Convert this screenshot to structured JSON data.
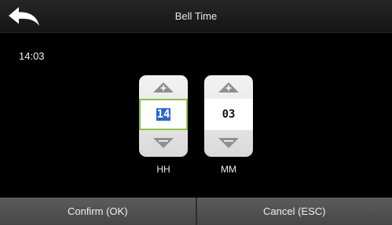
{
  "header": {
    "title": "Bell Time",
    "back_icon": "back-arrow-icon"
  },
  "current_time": "14:03",
  "time_picker": {
    "hour": {
      "value": "14",
      "label": "HH",
      "up_icon": "arrow-up-icon",
      "down_icon": "arrow-down-icon"
    },
    "minute": {
      "value": "03",
      "label": "MM",
      "up_icon": "arrow-up-icon",
      "down_icon": "arrow-down-icon"
    }
  },
  "footer": {
    "confirm_label": "Confirm (OK)",
    "cancel_label": "Cancel (ESC)"
  },
  "colors": {
    "background": "#000000",
    "focus_border": "#8cc63f",
    "selection": "#2a63d6",
    "footer_button": "#525252"
  }
}
